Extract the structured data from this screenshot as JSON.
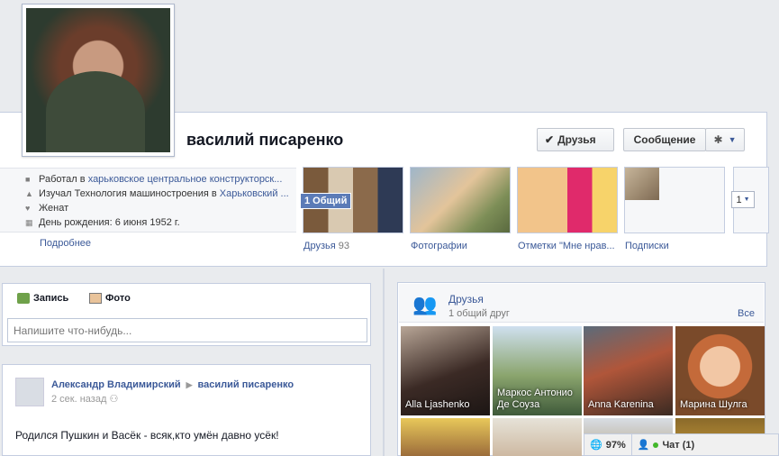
{
  "profile": {
    "name": "василий писаренко",
    "friend_button": "Друзья",
    "message_button": "Сообщение"
  },
  "info": {
    "work_prefix": "Работал в ",
    "work_link": "харьковское центральное конструкторск...",
    "study_prefix": "Изучал Технология машиностроения в ",
    "study_link": "Харьковский ...",
    "relationship": "Женат",
    "birthday": "День рождения: 6 июня 1952 г.",
    "more": "Подробнее"
  },
  "tiles": [
    {
      "label": "Друзья",
      "count": "93",
      "badge": "1 Общий"
    },
    {
      "label": "Фотографии"
    },
    {
      "label": "Отметки \"Мне нрав..."
    },
    {
      "label": "Подписки"
    }
  ],
  "tiles_dropdown": "1",
  "composer": {
    "tab_post": "Запись",
    "tab_photo": "Фото",
    "placeholder": "Напишите что-нибудь..."
  },
  "post": {
    "author": "Александр Владимирский",
    "target": "василий писаренко",
    "time": "2 сек. назад",
    "text": "Родился Пушкин и Васёк - всяк,кто умён давно усёк!"
  },
  "friends_box": {
    "title": "Друзья",
    "subtitle": "1 общий друг",
    "all_link": "Все",
    "friends": [
      {
        "name": "Alla Ljashenko"
      },
      {
        "name": "Маркос Антонио Де Соуза"
      },
      {
        "name": "Anna Karenina"
      },
      {
        "name": "Марина Шулга"
      }
    ]
  },
  "chatbar": {
    "percent": "97%",
    "chat": "Чат (1)"
  }
}
